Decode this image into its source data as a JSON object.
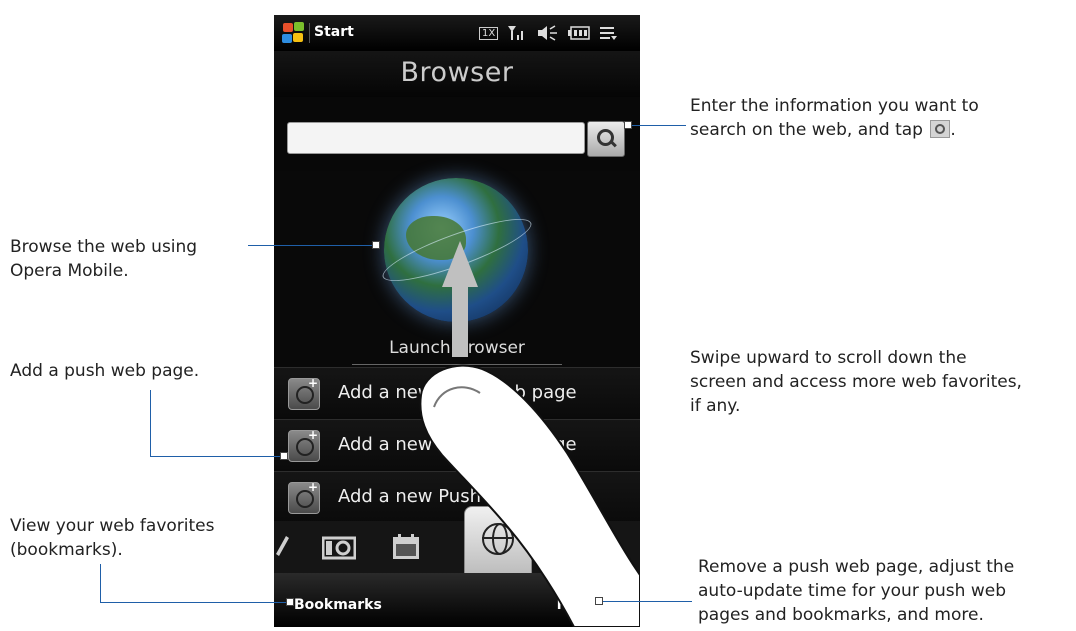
{
  "phone": {
    "status_bar": {
      "start_label": "Start",
      "icons": {
        "signal_badge": "1X",
        "signal": "signal-icon",
        "volume": "speaker-icon",
        "battery": "battery-icon",
        "menu": "menu-lines-icon"
      }
    },
    "title": "Browser",
    "search": {
      "value": "",
      "placeholder": ""
    },
    "launch": {
      "label": "Launch Browser"
    },
    "list_items": [
      {
        "label": "Add a new Push Web page"
      },
      {
        "label": "Add a new Push Web page"
      },
      {
        "label": "Add a new Push Web page"
      }
    ],
    "tabs": [
      "pencil-icon",
      "camera-icon",
      "calendar-icon",
      "internet-globe-icon"
    ],
    "softkeys": {
      "left": "Bookmarks",
      "right": "Menu"
    }
  },
  "callouts": {
    "search_line1": "Enter the information you want to",
    "search_line2": "search on the web, and tap",
    "search_line2_end": ".",
    "browse_line1": "Browse the web using",
    "browse_line2": "Opera Mobile.",
    "swipe_line1": "Swipe upward to scroll down the",
    "swipe_line2": "screen and access more web favorites,",
    "swipe_line3": "if any.",
    "push_line1": "Add a push web page.",
    "fav_line1": "View your web favorites",
    "fav_line2": "(bookmarks).",
    "menu_line1": "Remove a push web page, adjust the",
    "menu_line2": "auto-update time for your push web",
    "menu_line3": "pages and bookmarks, and more."
  },
  "colors": {
    "leader_line": "#1f5fa8",
    "phone_bg": "#0b0b0b"
  }
}
